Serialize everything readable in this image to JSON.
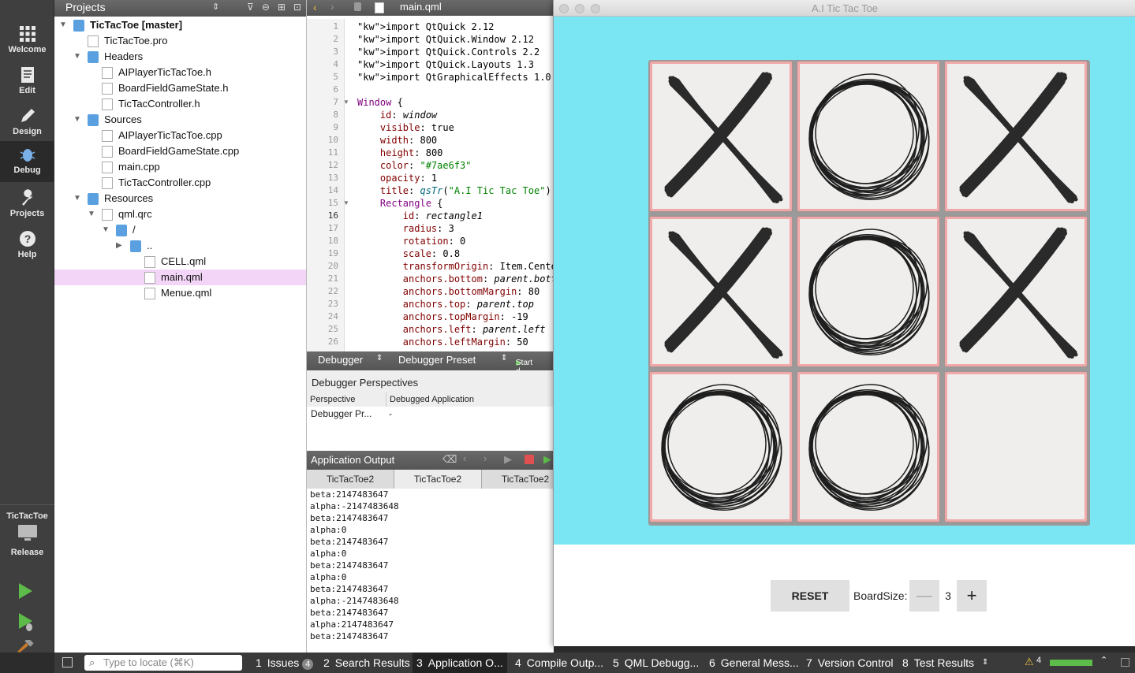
{
  "modes": [
    {
      "label": "Welcome",
      "icon": "grid-icon"
    },
    {
      "label": "Edit",
      "icon": "document-icon"
    },
    {
      "label": "Design",
      "icon": "pencil-icon"
    },
    {
      "label": "Debug",
      "icon": "bug-icon"
    },
    {
      "label": "Projects",
      "icon": "wrench-icon"
    },
    {
      "label": "Help",
      "icon": "help-icon"
    }
  ],
  "kit": {
    "name": "TicTacToe",
    "build": "Release"
  },
  "projects": {
    "title": "Projects",
    "tree": [
      {
        "label": "TicTacToe [master]",
        "bold": true,
        "depth": 0,
        "arrow": "down",
        "icon": "project"
      },
      {
        "label": "TicTacToe.pro",
        "depth": 1,
        "icon": "pro"
      },
      {
        "label": "Headers",
        "depth": 1,
        "arrow": "down",
        "icon": "folder"
      },
      {
        "label": "AIPlayerTicTacToe.h",
        "depth": 2,
        "icon": "file"
      },
      {
        "label": "BoardFieldGameState.h",
        "depth": 2,
        "icon": "file"
      },
      {
        "label": "TicTacController.h",
        "depth": 2,
        "icon": "file"
      },
      {
        "label": "Sources",
        "depth": 1,
        "arrow": "down",
        "icon": "folder"
      },
      {
        "label": "AIPlayerTicTacToe.cpp",
        "depth": 2,
        "icon": "file"
      },
      {
        "label": "BoardFieldGameState.cpp",
        "depth": 2,
        "icon": "file"
      },
      {
        "label": "main.cpp",
        "depth": 2,
        "icon": "file"
      },
      {
        "label": "TicTacController.cpp",
        "depth": 2,
        "icon": "file"
      },
      {
        "label": "Resources",
        "depth": 1,
        "arrow": "down",
        "icon": "lockfolder"
      },
      {
        "label": "qml.qrc",
        "depth": 2,
        "arrow": "down",
        "icon": "lock"
      },
      {
        "label": "/",
        "depth": 3,
        "arrow": "down",
        "icon": "folder"
      },
      {
        "label": "..",
        "depth": 4,
        "arrow": "right",
        "icon": "folder"
      },
      {
        "label": "CELL.qml",
        "depth": 5,
        "icon": "qml"
      },
      {
        "label": "main.qml",
        "depth": 5,
        "icon": "qml",
        "selected": true
      },
      {
        "label": "Menue.qml",
        "depth": 5,
        "icon": "qml"
      }
    ]
  },
  "editor": {
    "filename": "main.qml",
    "lines": [
      {
        "n": "1",
        "t": "import QtQuick 2.12"
      },
      {
        "n": "2",
        "t": "import QtQuick.Window 2.12"
      },
      {
        "n": "3",
        "t": "import QtQuick.Controls 2.2"
      },
      {
        "n": "4",
        "t": "import QtQuick.Layouts 1.3"
      },
      {
        "n": "5",
        "t": "import QtGraphicalEffects 1.0"
      },
      {
        "n": "6",
        "t": ""
      },
      {
        "n": "7",
        "t": "Window {"
      },
      {
        "n": "8",
        "t": "    id: window"
      },
      {
        "n": "9",
        "t": "    visible: true"
      },
      {
        "n": "10",
        "t": "    width: 800"
      },
      {
        "n": "11",
        "t": "    height: 800"
      },
      {
        "n": "12",
        "t": "    color: \"#7ae6f3\""
      },
      {
        "n": "13",
        "t": "    opacity: 1"
      },
      {
        "n": "14",
        "t": "    title: qsTr(\"A.I Tic Tac Toe\")"
      },
      {
        "n": "15",
        "t": "    Rectangle {"
      },
      {
        "n": "16",
        "t": "        id: rectangle1"
      },
      {
        "n": "17",
        "t": "        radius: 3"
      },
      {
        "n": "18",
        "t": "        rotation: 0"
      },
      {
        "n": "19",
        "t": "        scale: 0.8"
      },
      {
        "n": "20",
        "t": "        transformOrigin: Item.Cente"
      },
      {
        "n": "21",
        "t": "        anchors.bottom: parent.bott"
      },
      {
        "n": "22",
        "t": "        anchors.bottomMargin: 80"
      },
      {
        "n": "23",
        "t": "        anchors.top: parent.top"
      },
      {
        "n": "24",
        "t": "        anchors.topMargin: -19"
      },
      {
        "n": "25",
        "t": "        anchors.left: parent.left"
      },
      {
        "n": "26",
        "t": "        anchors.leftMargin: 50"
      }
    ]
  },
  "debugger": {
    "selector": "Debugger",
    "preset": "Debugger Preset",
    "start": "Start d",
    "perspectives_title": "Debugger Perspectives",
    "col_perspective": "Perspective",
    "col_app": "Debugged Application",
    "row_perspective": "Debugger Pr...",
    "row_app": "-"
  },
  "app_output": {
    "title": "Application Output",
    "tabs": [
      "TicTacToe2",
      "TicTacToe2",
      "TicTacToe2"
    ],
    "lines": [
      "beta:2147483647",
      "alpha:-2147483648",
      "beta:2147483647",
      "alpha:0",
      "beta:2147483647",
      "alpha:0",
      "beta:2147483647",
      "alpha:0",
      "beta:2147483647",
      "alpha:-2147483648",
      "beta:2147483647",
      "alpha:2147483647",
      "beta:2147483647"
    ]
  },
  "game": {
    "window_title": "A.I Tic Tac Toe",
    "background": "#7ae6f3",
    "board": [
      "X",
      "O",
      "X",
      "X",
      "O",
      "X",
      "O",
      "O",
      ""
    ],
    "reset_label": "RESET",
    "boardsize_label": "BoardSize:",
    "boardsize_value": "3",
    "minus": "—",
    "plus": "+"
  },
  "statusbar": {
    "locate_placeholder": "Type to locate (⌘K)",
    "tabs": [
      {
        "num": "1",
        "label": "Issues",
        "badge": "4"
      },
      {
        "num": "2",
        "label": "Search Results"
      },
      {
        "num": "3",
        "label": "Application O..."
      },
      {
        "num": "4",
        "label": "Compile Outp..."
      },
      {
        "num": "5",
        "label": "QML Debugg..."
      },
      {
        "num": "6",
        "label": "General Mess..."
      },
      {
        "num": "7",
        "label": "Version Control"
      },
      {
        "num": "8",
        "label": "Test Results"
      }
    ],
    "warnings": "4"
  }
}
